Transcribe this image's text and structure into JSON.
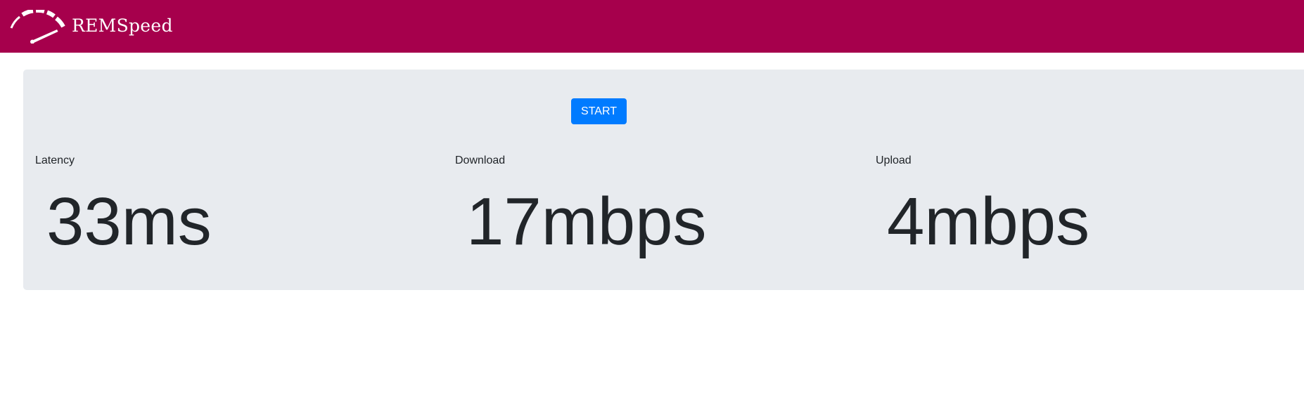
{
  "navbar": {
    "brand": "REMSpeed",
    "logo_icon": "speedometer-icon",
    "background": "#a6004c"
  },
  "main": {
    "start_label": "START",
    "accent": "#007bff",
    "metrics": [
      {
        "label": "Latency",
        "value": "33ms"
      },
      {
        "label": "Download",
        "value": "17mbps"
      },
      {
        "label": "Upload",
        "value": "4mbps"
      }
    ]
  }
}
